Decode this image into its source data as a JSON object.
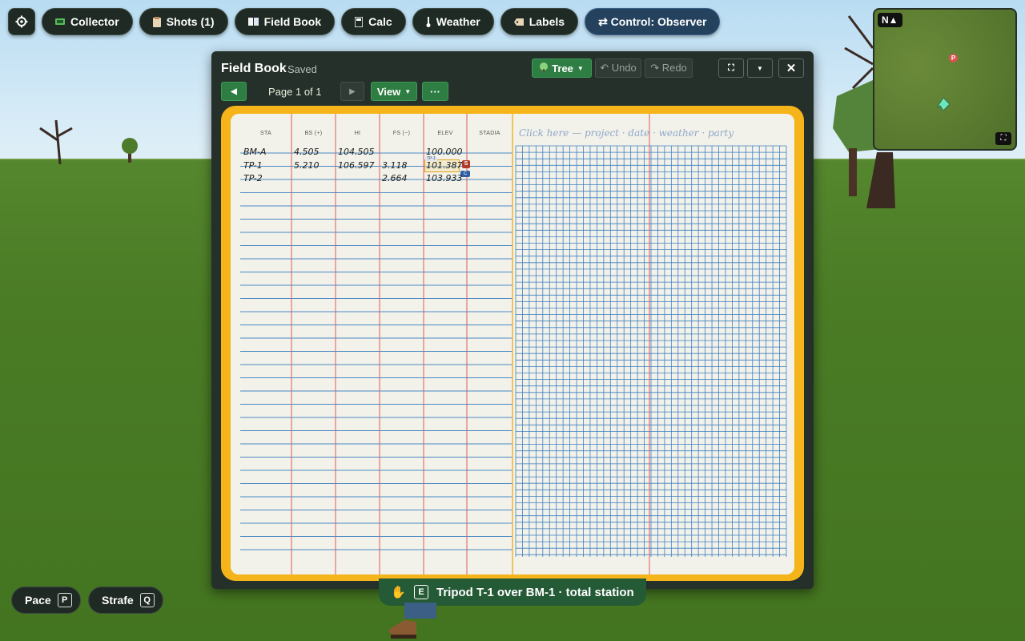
{
  "toolbar": {
    "settings_icon": "gear-icon",
    "items": [
      {
        "label": "Collector",
        "icon": "collector-icon"
      },
      {
        "label": "Shots (1)",
        "icon": "clipboard-icon"
      },
      {
        "label": "Field Book",
        "icon": "book-icon"
      },
      {
        "label": "Calc",
        "icon": "calculator-icon"
      },
      {
        "label": "Weather",
        "icon": "thermometer-icon"
      },
      {
        "label": "Labels",
        "icon": "tag-icon"
      }
    ],
    "control": {
      "label": "⇄ Control: Observer"
    }
  },
  "minimap": {
    "north": "N▲",
    "marker_label": "P"
  },
  "fieldbook": {
    "title": "Field Book",
    "status": "Saved",
    "tree_label": "Tree",
    "undo_label": "↶ Undo",
    "redo_label": "↷ Redo",
    "page_indicator": "Page 1 of 1",
    "view_label": "View",
    "more_label": "···",
    "columns": [
      "STA",
      "BS (+)",
      "HI",
      "FS (−)",
      "ELEV",
      "STADIA"
    ],
    "rows": [
      {
        "sta": "BM-A",
        "bs": "4.505",
        "hi": "104.505",
        "fs": "",
        "elev": "100.000"
      },
      {
        "sta": "TP-1",
        "bs": "5.210",
        "hi": "106.597",
        "fs": "3.118",
        "elev": "101.387"
      },
      {
        "sta": "TP-2",
        "bs": "",
        "hi": "",
        "fs": "2.664",
        "elev": "103.933"
      }
    ],
    "cell_tag": "TP-1",
    "tag_s": "S",
    "tag_c": "C",
    "header_hint": "Click here — project · date · weather · party"
  },
  "bottom": {
    "pace": {
      "label": "Pace",
      "key": "P"
    },
    "strafe": {
      "label": "Strafe",
      "key": "Q"
    },
    "prompt": {
      "key": "E",
      "text": "Tripod T-1 over BM-1 · total station"
    }
  },
  "colors": {
    "book_border": "#f4b41a",
    "panel": "#25302a",
    "grid_blue": "#3d7fc0",
    "margin_red": "#d9534f"
  }
}
